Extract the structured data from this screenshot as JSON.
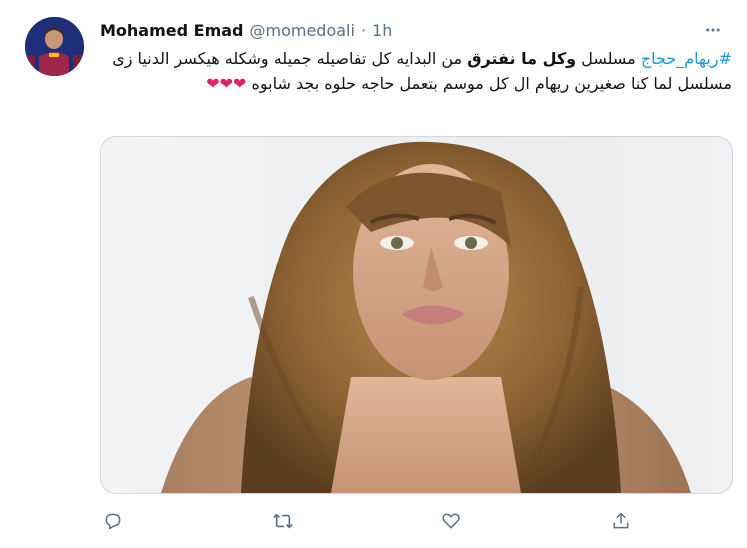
{
  "tweet": {
    "author_name": "Mohamed Emad",
    "handle": "@momedoali",
    "separator": "·",
    "time": "1h",
    "text": {
      "hashtag": "#ريهام_حجاج",
      "part1": " مسلسل ",
      "bold": "وكل ما نفترق",
      "part2": " من البدايه كل تفاصيله جميله وشكله هيكسر الدنيا زى مسلسل لما كنا صغيرين ريهام ال كل موسم بتعمل حاجه حلوه بجد شابوه ",
      "hearts": "❤❤❤"
    },
    "media_description": "Portrait photo of a woman with long wavy light-brown hair",
    "accent_color": "#1b95e0",
    "heart_color": "#e0245e"
  },
  "icons": {
    "more": "more-icon",
    "reply": "reply-icon",
    "retweet": "retweet-icon",
    "like": "like-icon",
    "share": "share-icon"
  }
}
